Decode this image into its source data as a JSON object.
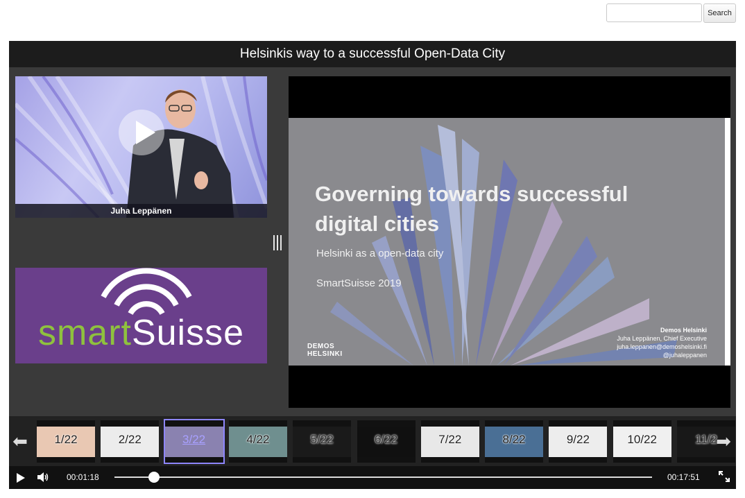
{
  "search": {
    "placeholder": "",
    "button_label": "Search"
  },
  "title": "Helsinkis way to a successful Open-Data City",
  "video": {
    "presenter_name": "Juha Leppänen"
  },
  "logo": {
    "brand_first": "smart",
    "brand_second": "Suisse"
  },
  "slide": {
    "title_line1": "Governing towards successful",
    "title_line2": "digital cities",
    "subtitle": "Helsinki as a open-data city",
    "event": "SmartSuisse 2019",
    "org_line1": "DEMOS",
    "org_line2": "HELSINKI",
    "contact_org": "Demos Helsinki",
    "contact_name": "Juha Leppänen, Chief Executive",
    "contact_email": "juha.leppanen@demoshelsinki.fi",
    "contact_handle": "@juhaleppanen"
  },
  "thumbnails": {
    "current": 3,
    "items": [
      {
        "label": "1/22",
        "tone": "#e9c8b3"
      },
      {
        "label": "2/22",
        "tone": "#ececec"
      },
      {
        "label": "3/22",
        "tone": "#8a82b0"
      },
      {
        "label": "4/22",
        "tone": "#6f8f8f"
      },
      {
        "label": "5/22",
        "tone": "#1a1a1a"
      },
      {
        "label": "6/22",
        "tone": "#101010"
      },
      {
        "label": "7/22",
        "tone": "#e8e8e8"
      },
      {
        "label": "8/22",
        "tone": "#4a6f95"
      },
      {
        "label": "9/22",
        "tone": "#ededed"
      },
      {
        "label": "10/22",
        "tone": "#f0f0f0"
      },
      {
        "label": "11/2",
        "tone": "#181818"
      }
    ]
  },
  "controls": {
    "current_time": "00:01:18",
    "total_time": "00:17:51",
    "progress_fraction": 0.073
  },
  "colors": {
    "accent": "#8e86ff",
    "logo_bg": "#6a3f8b",
    "logo_green": "#8fc13e"
  },
  "icons": [
    "prev-arrow-icon",
    "next-arrow-icon",
    "play-icon",
    "volume-icon",
    "fullscreen-icon"
  ]
}
